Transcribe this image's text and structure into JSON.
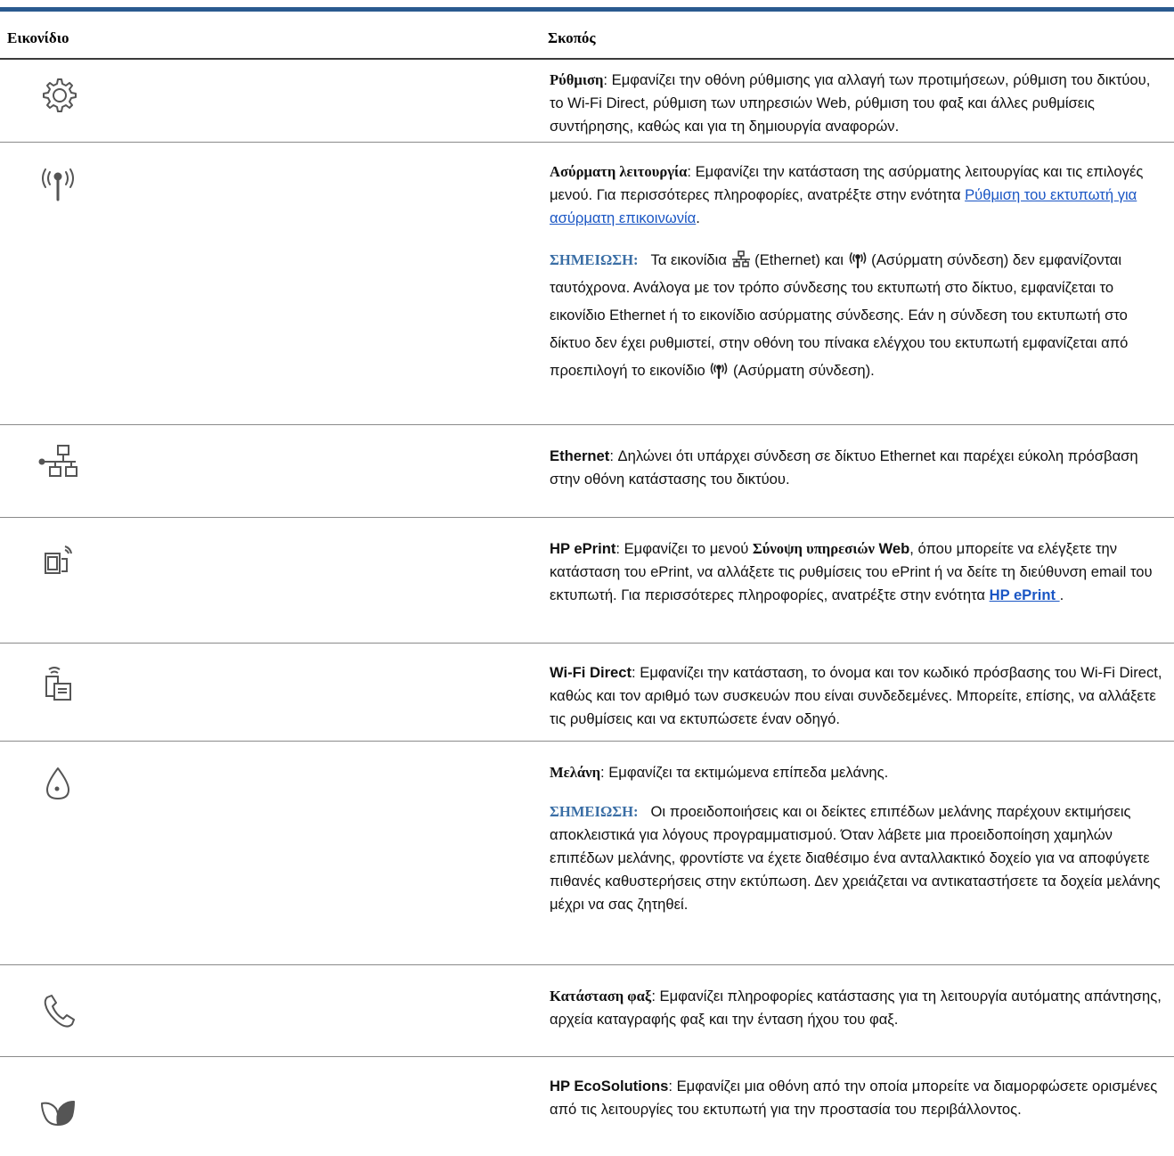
{
  "header": {
    "col_icon": "Εικονίδιο",
    "col_purpose": "Σκοπός"
  },
  "rows": {
    "setup": {
      "icon": "gear-icon",
      "title": "Ρύθμιση",
      "desc": ": Εμφανίζει την οθόνη ρύθμισης για αλλαγή των προτιμήσεων, ρύθμιση του δικτύου, το Wi-Fi Direct, ρύθμιση των υπηρεσιών Web, ρύθμιση του φαξ και άλλες ρυθμίσεις συντήρησης, καθώς και για τη δημιουργία αναφορών."
    },
    "wireless": {
      "icon": "wireless-antenna-icon",
      "title": "Ασύρματη λειτουργία",
      "desc": ": Εμφανίζει την κατάσταση της ασύρματης λειτουργίας και τις επιλογές μενού. Για περισσότερες πληροφορίες, ανατρέξτε στην ενότητα ",
      "link": "Ρύθμιση του εκτυπωτή για ασύρματη επικοινωνία",
      "desc_end": ".",
      "note_label": "ΣΗΜΕΙΩΣΗ:",
      "note_1": "Τα εικονίδια ",
      "note_2": " (Ethernet) και ",
      "note_3": " (Ασύρματη σύνδεση) δεν εμφανίζονται ταυτόχρονα. Ανάλογα με τον τρόπο σύνδεσης του εκτυπωτή στο δίκτυο, εμφανίζεται το εικονίδιο Ethernet ή το εικονίδιο ασύρματης σύνδεσης. Εάν η σύνδεση του εκτυπωτή στο δίκτυο δεν έχει ρυθμιστεί, στην οθόνη του πίνακα ελέγχου του εκτυπωτή εμφανίζεται από προεπιλογή το εικονίδιο ",
      "note_4": " (Ασύρματη σύνδεση)."
    },
    "ethernet": {
      "icon": "ethernet-network-icon",
      "title": "Ethernet",
      "desc": ": Δηλώνει ότι υπάρχει σύνδεση σε δίκτυο Ethernet και παρέχει εύκολη πρόσβαση στην οθόνη κατάστασης του δικτύου."
    },
    "eprint": {
      "icon": "eprint-icon",
      "title": "HP ePrint",
      "desc_1": ": Εμφανίζει το μενού ",
      "menu": "Σύνοψη υπηρεσιών",
      "menu_web": " Web",
      "desc_2": ", όπου μπορείτε να ελέγξετε την κατάσταση του ePrint, να αλλάξετε τις ρυθμίσεις του ePrint ή να δείτε τη διεύθυνση email του εκτυπωτή. Για περισσότερες πληροφορίες, ανατρέξτε στην ενότητα ",
      "link": "HP ePrint ",
      "desc_end": "."
    },
    "wifi_direct": {
      "icon": "wifi-direct-icon",
      "title": "Wi-Fi Direct",
      "desc": ": Εμφανίζει την κατάσταση, το όνομα και τον κωδικό πρόσβασης του Wi-Fi Direct, καθώς και τον αριθμό των συσκευών που είναι συνδεδεμένες. Μπορείτε, επίσης, να αλλάξετε τις ρυθμίσεις και να εκτυπώσετε έναν οδηγό."
    },
    "ink": {
      "icon": "ink-drop-icon",
      "title": "Μελάνη",
      "desc": ": Εμφανίζει τα εκτιμώμενα επίπεδα μελάνης.",
      "note_label": "ΣΗΜΕΙΩΣΗ:",
      "note": "Οι προειδοποιήσεις και οι δείκτες επιπέδων μελάνης παρέχουν εκτιμήσεις αποκλειστικά για λόγους προγραμματισμού. Όταν λάβετε μια προειδοποίηση χαμηλών επιπέδων μελάνης, φροντίστε να έχετε διαθέσιμο ένα ανταλλακτικό δοχείο για να αποφύγετε πιθανές καθυστερήσεις στην εκτύπωση. Δεν χρειάζεται να αντικαταστήσετε τα δοχεία μελάνης μέχρι να σας ζητηθεί."
    },
    "fax": {
      "icon": "phone-handset-icon",
      "title": "Κατάσταση φαξ",
      "desc": ": Εμφανίζει πληροφορίες κατάστασης για τη λειτουργία αυτόματης απάντησης, αρχεία καταγραφής φαξ και την ένταση ήχου του φαξ."
    },
    "eco": {
      "icon": "leaf-icon",
      "title": "HP EcoSolutions",
      "desc": ": Εμφανίζει μια οθόνη από την οποία μπορείτε να διαμορφώσετε ορισμένες από τις λειτουργίες του εκτυπωτή για την προστασία του περιβάλλοντος."
    }
  }
}
